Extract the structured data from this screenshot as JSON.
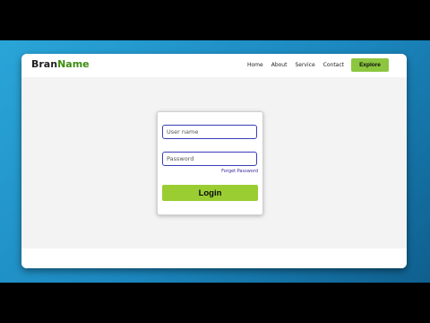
{
  "navbar": {
    "brand_prefix": "Bran",
    "brand_suffix": "Name",
    "links": [
      "Home",
      "About",
      "Service",
      "Contact"
    ],
    "explore_label": "Explore"
  },
  "login": {
    "username_placeholder": "User name",
    "password_placeholder": "Password",
    "forget_label": "Forget Password",
    "login_label": "Login"
  },
  "colors": {
    "background_gradient": [
      "#2aa5d8",
      "#0f5f8e"
    ],
    "accent_green": "#8cc63f",
    "field_border": "#3c3cb8",
    "link_color": "#3a2b9e"
  }
}
